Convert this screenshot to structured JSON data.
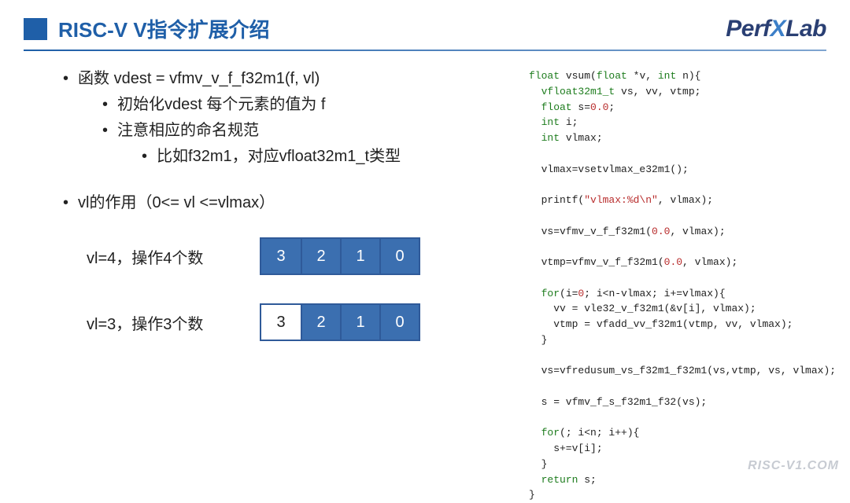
{
  "header": {
    "title": "RISC-V V指令扩展介绍",
    "logo_perf": "Perf",
    "logo_x": "X",
    "logo_lab": "Lab"
  },
  "bullets": {
    "b1": "函数 vdest = vfmv_v_f_f32m1(f, vl)",
    "b1a": "初始化vdest 每个元素的值为 f",
    "b1b": "注意相应的命名规范",
    "b1b1": "比如f32m1，对应vfloat32m1_t类型",
    "b2": "vl的作用（0<= vl <=vlmax）"
  },
  "diagrams": {
    "row1_label": "vl=4，操作4个数",
    "row1_cells": [
      "3",
      "2",
      "1",
      "0"
    ],
    "row2_label": "vl=3，操作3个数",
    "row2_cells_empty": "3",
    "row2_cells": [
      "2",
      "1",
      "0"
    ]
  },
  "code": {
    "l01a": "float",
    "l01b": " vsum(",
    "l01c": "float",
    "l01d": " *v, ",
    "l01e": "int",
    "l01f": " n){",
    "l02a": "  vfloat32m1_t",
    "l02b": " vs, vv, vtmp;",
    "l03a": "  float",
    "l03b": " s=",
    "l03c": "0.0",
    "l03d": ";",
    "l04a": "  int",
    "l04b": " i;",
    "l05a": "  int",
    "l05b": " vlmax;",
    "l07": "  vlmax=vsetvlmax_e32m1();",
    "l08a": "  printf(",
    "l08b": "\"vlmax:%d\\n\"",
    "l08c": ", vlmax);",
    "l09a": "  vs=vfmv_v_f_f32m1(",
    "l09b": "0.0",
    "l09c": ", vlmax);",
    "l10a": "  vtmp=vfmv_v_f_f32m1(",
    "l10b": "0.0",
    "l10c": ", vlmax);",
    "l11a": "  for",
    "l11b": "(i=",
    "l11c": "0",
    "l11d": "; i<n-vlmax; i+=vlmax){",
    "l12": "    vv = vle32_v_f32m1(&v[i], vlmax);",
    "l13": "    vtmp = vfadd_vv_f32m1(vtmp, vv, vlmax);",
    "l14": "  }",
    "l15": "  vs=vfredusum_vs_f32m1_f32m1(vs,vtmp, vs, vlmax);",
    "l16": "  s = vfmv_f_s_f32m1_f32(vs);",
    "l17a": "  for",
    "l17b": "(; i<n; i++){",
    "l18": "    s+=v[i];",
    "l19": "  }",
    "l20a": "  return",
    "l20b": " s;",
    "l21": "}"
  },
  "watermark": "RISC-V1.COM"
}
